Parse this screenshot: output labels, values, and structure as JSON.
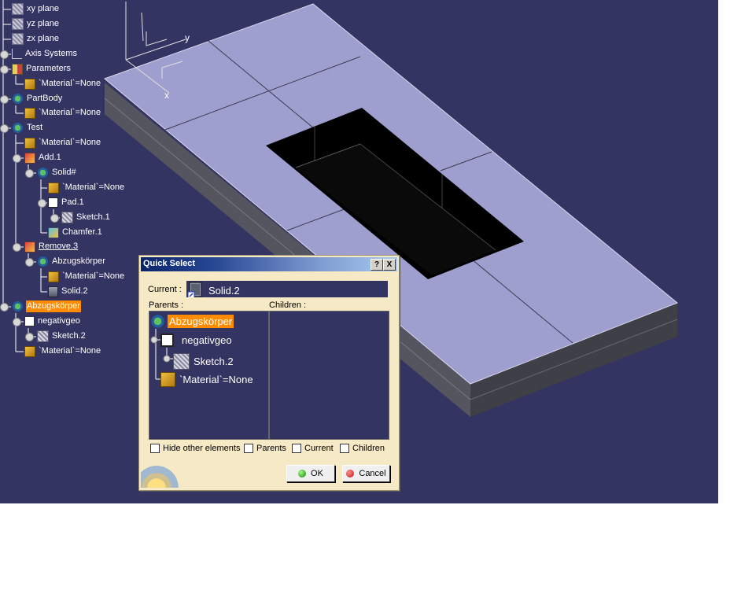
{
  "colors": {
    "viewport_bg": "#343462",
    "selection": "#ff8c00",
    "dialog_bg": "#f6e9c6",
    "plate_top": "#9f9fcf",
    "plate_side": "#5a5a66",
    "hole": "#000000"
  },
  "tree": [
    {
      "label": "xy plane",
      "icon": "plane-icon"
    },
    {
      "label": "yz plane",
      "icon": "plane-icon"
    },
    {
      "label": "zx plane",
      "icon": "plane-icon"
    },
    {
      "label": "Axis Systems",
      "icon": "axis-systems-icon"
    },
    {
      "label": "Parameters",
      "icon": "parameters-icon"
    },
    {
      "label": "`Material`=None",
      "icon": "material-icon"
    },
    {
      "label": "PartBody",
      "icon": "body-icon"
    },
    {
      "label": "`Material`=None",
      "icon": "material-icon"
    },
    {
      "label": "Test",
      "icon": "body-icon"
    },
    {
      "label": "`Material`=None",
      "icon": "material-icon"
    },
    {
      "label": "Add.1",
      "icon": "add-operation-icon"
    },
    {
      "label": "Solid#",
      "icon": "body-icon"
    },
    {
      "label": "`Material`=None",
      "icon": "material-icon"
    },
    {
      "label": "Pad.1",
      "icon": "pad-icon"
    },
    {
      "label": "Sketch.1",
      "icon": "sketch-icon"
    },
    {
      "label": "Chamfer.1",
      "icon": "chamfer-icon"
    },
    {
      "label": "Remove.3",
      "icon": "remove-operation-icon"
    },
    {
      "label": "Abzugskörper",
      "icon": "body-icon"
    },
    {
      "label": "`Material`=None",
      "icon": "material-icon"
    },
    {
      "label": "Solid.2",
      "icon": "solid-icon"
    },
    {
      "label": "Abzugskörper",
      "icon": "body-icon"
    },
    {
      "label": "negativgeo",
      "icon": "geometric-set-icon"
    },
    {
      "label": "Sketch.2",
      "icon": "sketch-icon"
    },
    {
      "label": "`Material`=None",
      "icon": "material-icon"
    }
  ],
  "compass": {
    "y_label": "y",
    "x_label": "x"
  },
  "dialog": {
    "title": "Quick Select",
    "help": "?",
    "close": "X",
    "current_label": "Current :",
    "current_value": "Solid.2",
    "parents_label": "Parents :",
    "children_label": "Children :",
    "parents_tree": [
      {
        "label": "Abzugskörper",
        "icon": "body-icon"
      },
      {
        "label": "negativgeo",
        "icon": "geometric-set-icon"
      },
      {
        "label": "Sketch.2",
        "icon": "sketch-icon"
      },
      {
        "label": "`Material`=None",
        "icon": "material-icon"
      }
    ],
    "checkboxes": [
      {
        "label": "Hide other elements",
        "checked": false
      },
      {
        "label": "Parents",
        "checked": false
      },
      {
        "label": "Current",
        "checked": false
      },
      {
        "label": "Children",
        "checked": false
      }
    ],
    "ok_label": "OK",
    "cancel_label": "Cancel"
  }
}
